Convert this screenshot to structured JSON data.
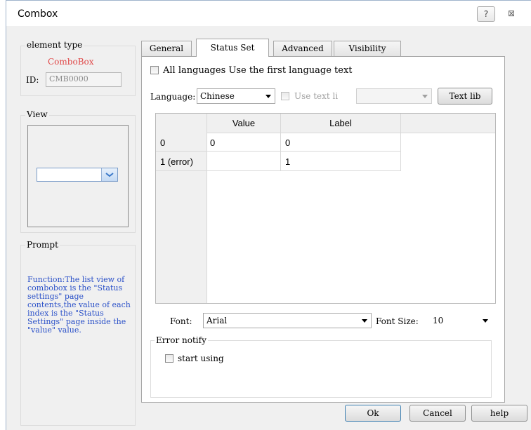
{
  "window": {
    "title": "Combox",
    "help_glyph": "?",
    "close_glyph": "⊠"
  },
  "element_type": {
    "legend": "element type",
    "value": "ComboBox",
    "id_label": "ID:",
    "id_value": "CMB0000"
  },
  "view": {
    "legend": "View"
  },
  "prompt": {
    "legend": "Prompt",
    "text": "Function:The list view of combobox is the \"Status settings\" page contents,the value of each index is the \"Status Settings\" page inside the \"value\" value."
  },
  "tabs": [
    {
      "label": "General",
      "active": false
    },
    {
      "label": "Status Set",
      "active": true
    },
    {
      "label": "Advanced",
      "active": false
    },
    {
      "label": "Visibility",
      "active": false
    }
  ],
  "status_set": {
    "all_languages_label": "All languages Use the first language text",
    "language_label": "Language:",
    "language_value": "Chinese",
    "use_text_label": "Use text li",
    "text_lib_button": "Text lib",
    "columns": [
      "Value",
      "Label"
    ],
    "rows": [
      {
        "index": "0",
        "value": "0",
        "label": "0"
      },
      {
        "index": "1 (error)",
        "value": "",
        "label": "1"
      }
    ],
    "font_label": "Font:",
    "font_value": "Arial",
    "font_size_label": "Font Size:",
    "font_size_value": "10",
    "error_notify_legend": "Error notify",
    "start_using_label": "start using"
  },
  "footer": {
    "ok": "Ok",
    "cancel": "Cancel",
    "help": "help"
  },
  "colors": {
    "accent_text": "#e04848",
    "prompt_text": "#2a50c8",
    "dropdown_arrow": "#3a78c8"
  }
}
